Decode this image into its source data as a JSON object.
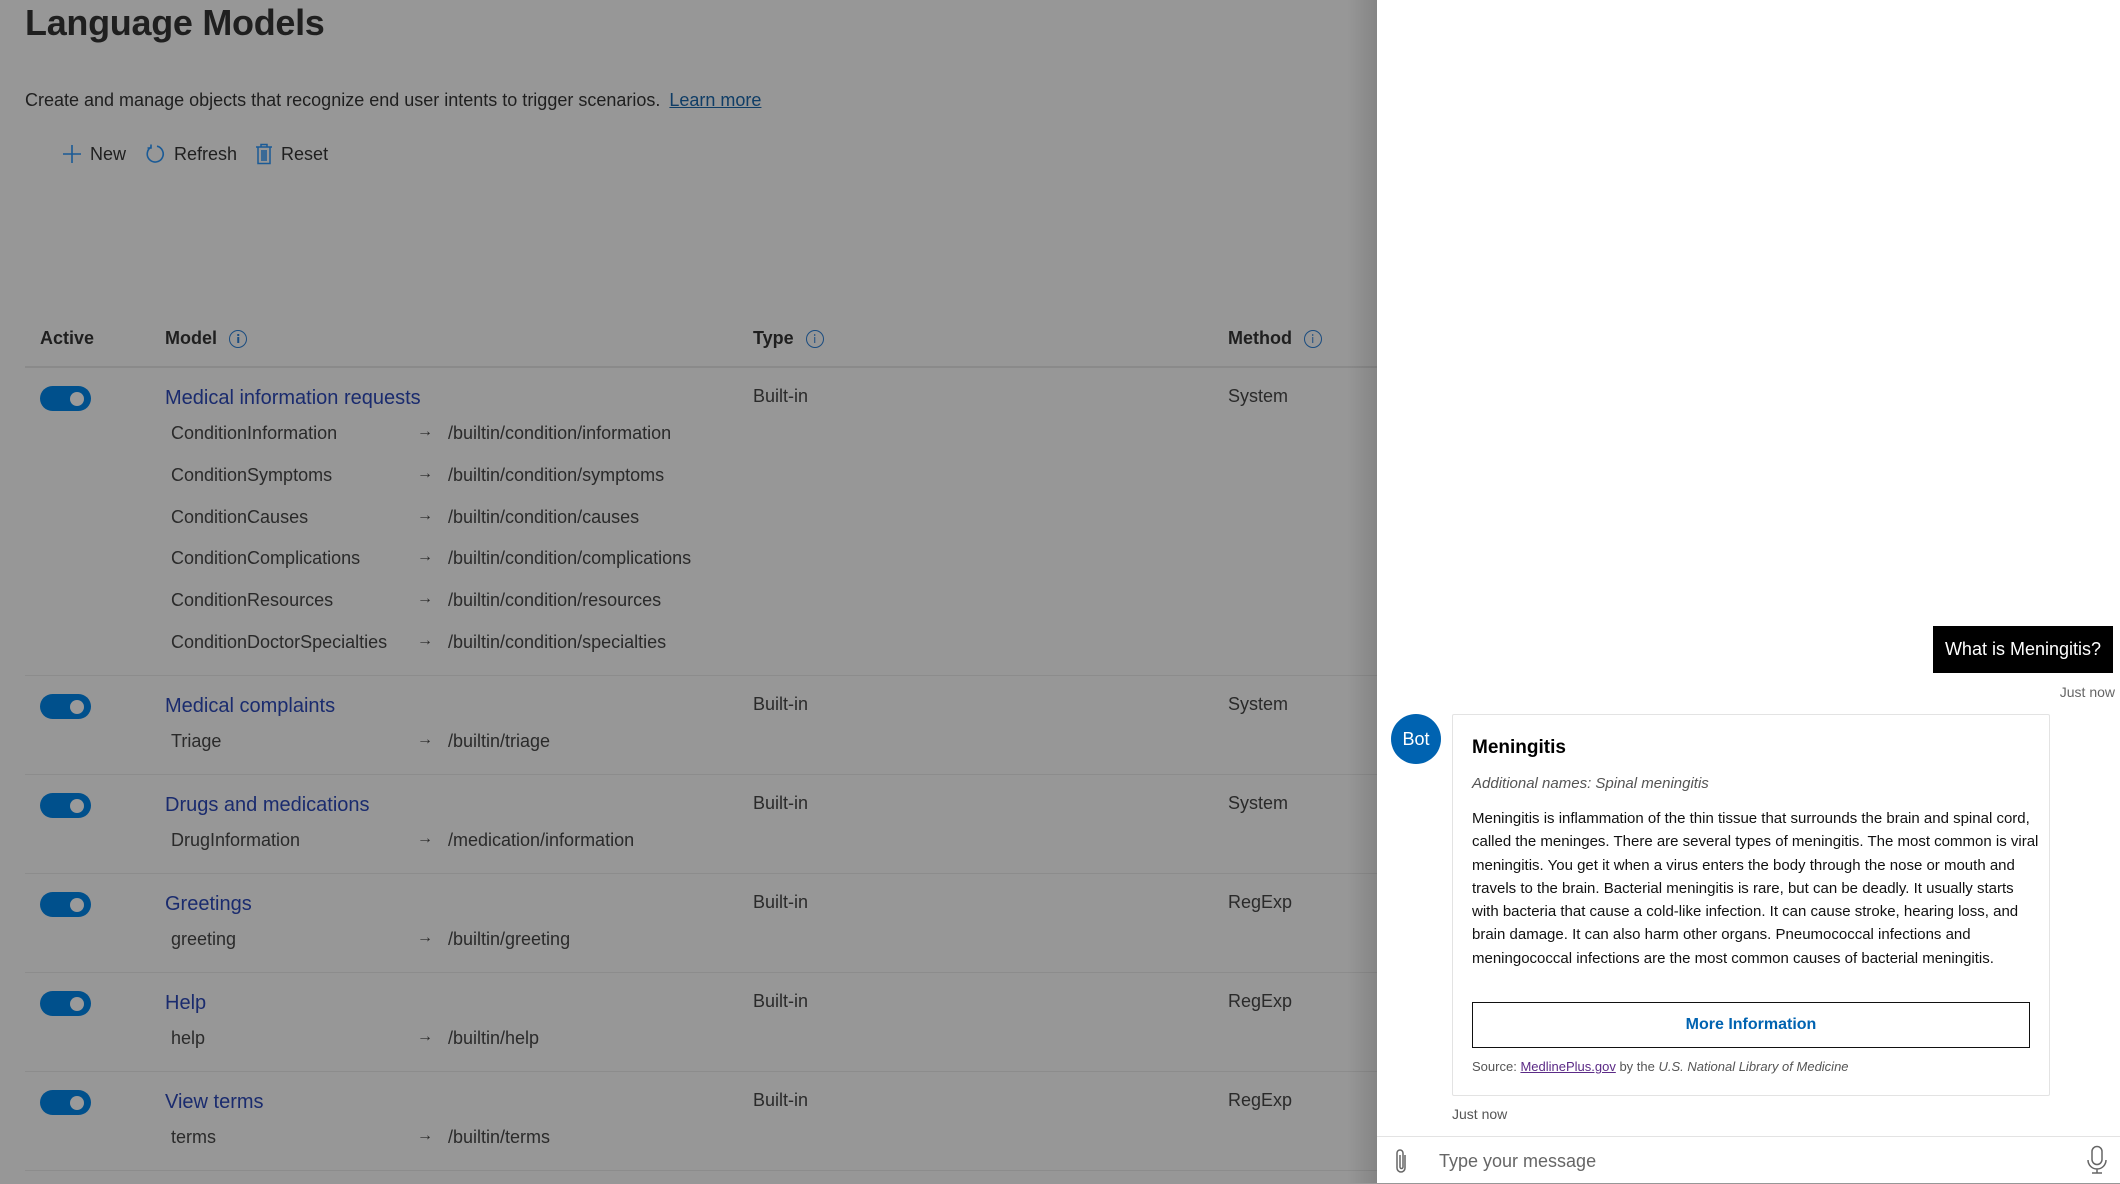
{
  "page": {
    "title": "Language Models",
    "description": "Create and manage objects that recognize end user intents to trigger scenarios.",
    "learn_more": "Learn more"
  },
  "toolbar": {
    "new_label": "New",
    "refresh_label": "Refresh",
    "reset_label": "Reset"
  },
  "table": {
    "headers": {
      "active": "Active",
      "model": "Model",
      "type": "Type",
      "method": "Method"
    },
    "rows": [
      {
        "active": true,
        "name": "Medical information requests",
        "type": "Built-in",
        "method": "System",
        "intents": [
          {
            "intent": "ConditionInformation",
            "route": "/builtin/condition/information"
          },
          {
            "intent": "ConditionSymptoms",
            "route": "/builtin/condition/symptoms"
          },
          {
            "intent": "ConditionCauses",
            "route": "/builtin/condition/causes"
          },
          {
            "intent": "ConditionComplications",
            "route": "/builtin/condition/complications"
          },
          {
            "intent": "ConditionResources",
            "route": "/builtin/condition/resources"
          },
          {
            "intent": "ConditionDoctorSpecialties",
            "route": "/builtin/condition/specialties"
          }
        ]
      },
      {
        "active": true,
        "name": "Medical complaints",
        "type": "Built-in",
        "method": "System",
        "intents": [
          {
            "intent": "Triage",
            "route": "/builtin/triage"
          }
        ]
      },
      {
        "active": true,
        "name": "Drugs and medications",
        "type": "Built-in",
        "method": "System",
        "intents": [
          {
            "intent": "DrugInformation",
            "route": "/medication/information"
          }
        ]
      },
      {
        "active": true,
        "name": "Greetings",
        "type": "Built-in",
        "method": "RegExp",
        "intents": [
          {
            "intent": "greeting",
            "route": "/builtin/greeting"
          }
        ]
      },
      {
        "active": true,
        "name": "Help",
        "type": "Built-in",
        "method": "RegExp",
        "intents": [
          {
            "intent": "help",
            "route": "/builtin/help"
          }
        ]
      },
      {
        "active": true,
        "name": "View terms",
        "type": "Built-in",
        "method": "RegExp",
        "intents": [
          {
            "intent": "terms",
            "route": "/builtin/terms"
          }
        ]
      }
    ],
    "arrow_glyph": "→"
  },
  "chat": {
    "user_message": "What is Meningitis?",
    "user_timestamp": "Just now",
    "bot_avatar_label": "Bot",
    "card": {
      "title": "Meningitis",
      "subtitle": "Additional names: Spinal meningitis",
      "body": "Meningitis is inflammation of the thin tissue that surrounds the brain and spinal cord, called the meninges. There are several types of meningitis. The most common is viral meningitis. You get it when a virus enters the body through the nose or mouth and travels to the brain. Bacterial meningitis is rare, but can be deadly. It usually starts with bacteria that cause a cold-like infection. It can cause stroke, hearing loss, and brain damage. It can also harm other organs. Pneumococcal infections and meningococcal infections are the most common causes of bacterial meningitis.",
      "button_label": "More Information",
      "source_prefix": "Source:",
      "source_link": "MedlinePlus.gov",
      "source_by": "by the",
      "source_org": "U.S. National Library of Medicine"
    },
    "bot_timestamp": "Just now",
    "input_placeholder": "Type your message"
  },
  "colors": {
    "accent": "#00508c",
    "bot_avatar": "#0063b1",
    "link_dark": "#1a2b6e",
    "overlay": "#979797"
  }
}
